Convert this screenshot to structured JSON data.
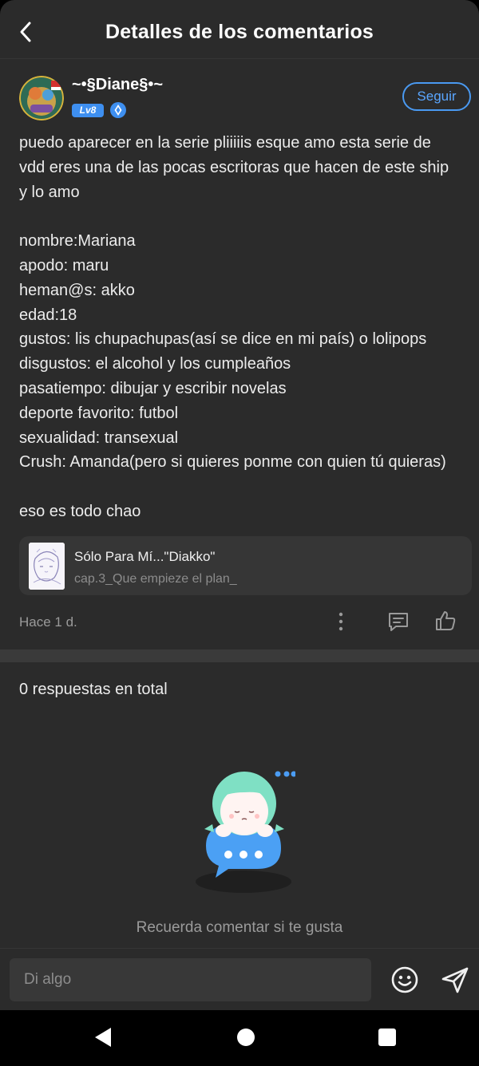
{
  "header": {
    "title": "Detalles de los comentarios",
    "back_icon": "chevron-left-icon"
  },
  "author": {
    "username": "~•§Diane§•~",
    "level": "Lv8",
    "verify_icon": "verified-shield-icon",
    "follow_label": "Seguir"
  },
  "comment": {
    "lines": [
      "puedo aparecer en la serie pliiiiis esque amo esta serie de",
      "vdd eres una de las pocas escritoras que hacen de este ship",
      "y lo amo",
      "",
      "nombre:Mariana",
      "apodo: maru",
      "heman@s: akko",
      "edad:18",
      "gustos: lis chupachupas(así se dice en mi país) o lolipops",
      "disgustos: el alcohol y los cumpleaños",
      "pasatiempo: dibujar y escribir novelas",
      "deporte favorito: futbol",
      "sexualidad: transexual",
      "Crush: Amanda(pero si quieres ponme con quien tú quieras)",
      "",
      "eso es todo chao"
    ]
  },
  "story": {
    "title": "Sólo Para Mí...\"Diakko\"",
    "chapter": "cap.3_Que empieze el plan_"
  },
  "meta": {
    "timestamp": "Hace 1 d.",
    "more_icon": "more-vertical-icon",
    "reply_icon": "comment-icon",
    "like_icon": "thumbs-up-icon"
  },
  "replies": {
    "count_label": "0 respuestas en total",
    "empty_message": "Recuerda comentar si te gusta"
  },
  "input": {
    "placeholder": "Di algo",
    "emoji_icon": "smiley-icon",
    "send_icon": "send-icon"
  },
  "colors": {
    "background": "#2b2b2b",
    "accent": "#4a9af2",
    "level_badge": "#3e8ff0"
  }
}
